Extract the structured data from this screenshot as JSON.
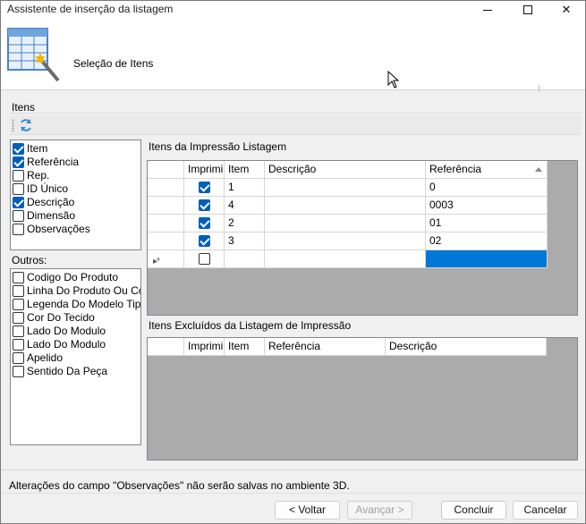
{
  "window": {
    "title": "Assistente de inserção da listagem",
    "step_title": "Seleção de Itens"
  },
  "group": {
    "label": "Itens"
  },
  "fields_list": {
    "items": [
      {
        "label": "Item",
        "checked": true
      },
      {
        "label": "Referência",
        "checked": true
      },
      {
        "label": "Rep.",
        "checked": false
      },
      {
        "label": "ID Único",
        "checked": false
      },
      {
        "label": "Descrição",
        "checked": true
      },
      {
        "label": "Dimensão",
        "checked": false
      },
      {
        "label": "Observações",
        "checked": false
      }
    ]
  },
  "others": {
    "label": "Outros:",
    "items": [
      {
        "label": "Codigo Do Produto",
        "checked": false
      },
      {
        "label": "Linha Do Produto Ou Coc",
        "checked": false
      },
      {
        "label": "Legenda Do Modelo Tipo",
        "checked": false
      },
      {
        "label": "Cor Do Tecido",
        "checked": false
      },
      {
        "label": "Lado Do Modulo",
        "checked": false
      },
      {
        "label": "Lado Do Modulo",
        "checked": false
      },
      {
        "label": "Apelido",
        "checked": false
      },
      {
        "label": "Sentido Da Peça",
        "checked": false
      }
    ]
  },
  "print_grid": {
    "label": "Itens da Impressão Listagem",
    "columns": [
      "Imprimir",
      "Item",
      "Descrição",
      "Referência"
    ],
    "rows": [
      {
        "imprimir": true,
        "item": "1",
        "descricao": "",
        "referencia": "0"
      },
      {
        "imprimir": true,
        "item": "4",
        "descricao": "",
        "referencia": "0003"
      },
      {
        "imprimir": true,
        "item": "2",
        "descricao": "",
        "referencia": "01"
      },
      {
        "imprimir": true,
        "item": "3",
        "descricao": "",
        "referencia": "02"
      }
    ],
    "new_row_marker": "▸*"
  },
  "excluded_grid": {
    "label": "Itens Excluídos da Listagem de Impressão",
    "columns": [
      "Imprimir",
      "Item",
      "Referência",
      "Descrição"
    ]
  },
  "status": "Alterações do campo \"Observações\" não serão salvas no ambiente 3D.",
  "buttons": {
    "back": "< Voltar",
    "next": "Avançar >",
    "finish": "Concluir",
    "cancel": "Cancelar"
  },
  "colors": {
    "accent": "#005fb8",
    "selection": "#0078d7",
    "grid_bg": "#ababab"
  }
}
